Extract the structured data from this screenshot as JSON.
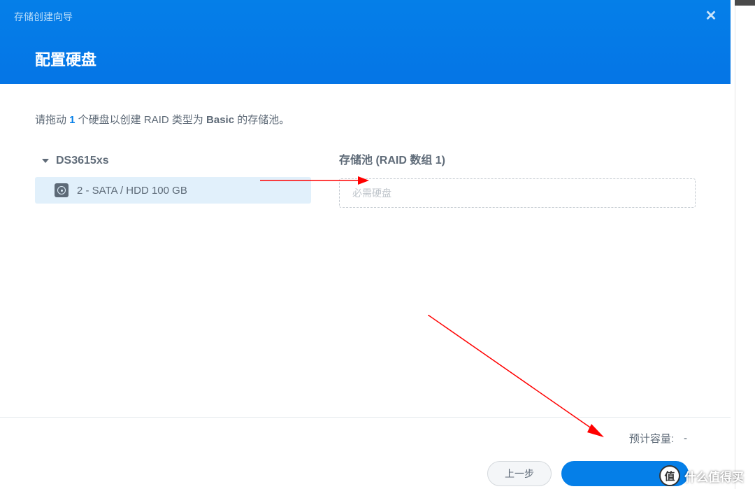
{
  "header": {
    "small_title": "存储创建向导",
    "main_title": "配置硬盘",
    "close_label": "✕"
  },
  "instruction": {
    "prefix": "请拖动 ",
    "count": "1",
    "mid": " 个硬盘以创建 RAID 类型为 ",
    "type": "Basic",
    "suffix": " 的存储池。"
  },
  "device": {
    "name": "DS3615xs",
    "disks": [
      {
        "label": "2 - SATA / HDD 100 GB"
      }
    ]
  },
  "pool": {
    "title": "存储池 (RAID 数组 1)",
    "placeholder": "必需硬盘"
  },
  "footer": {
    "capacity_label": "预计容量:",
    "capacity_value": "-",
    "prev_button": "上一步",
    "next_button": " "
  },
  "watermark": {
    "badge": "值",
    "text": "什么值得买"
  }
}
